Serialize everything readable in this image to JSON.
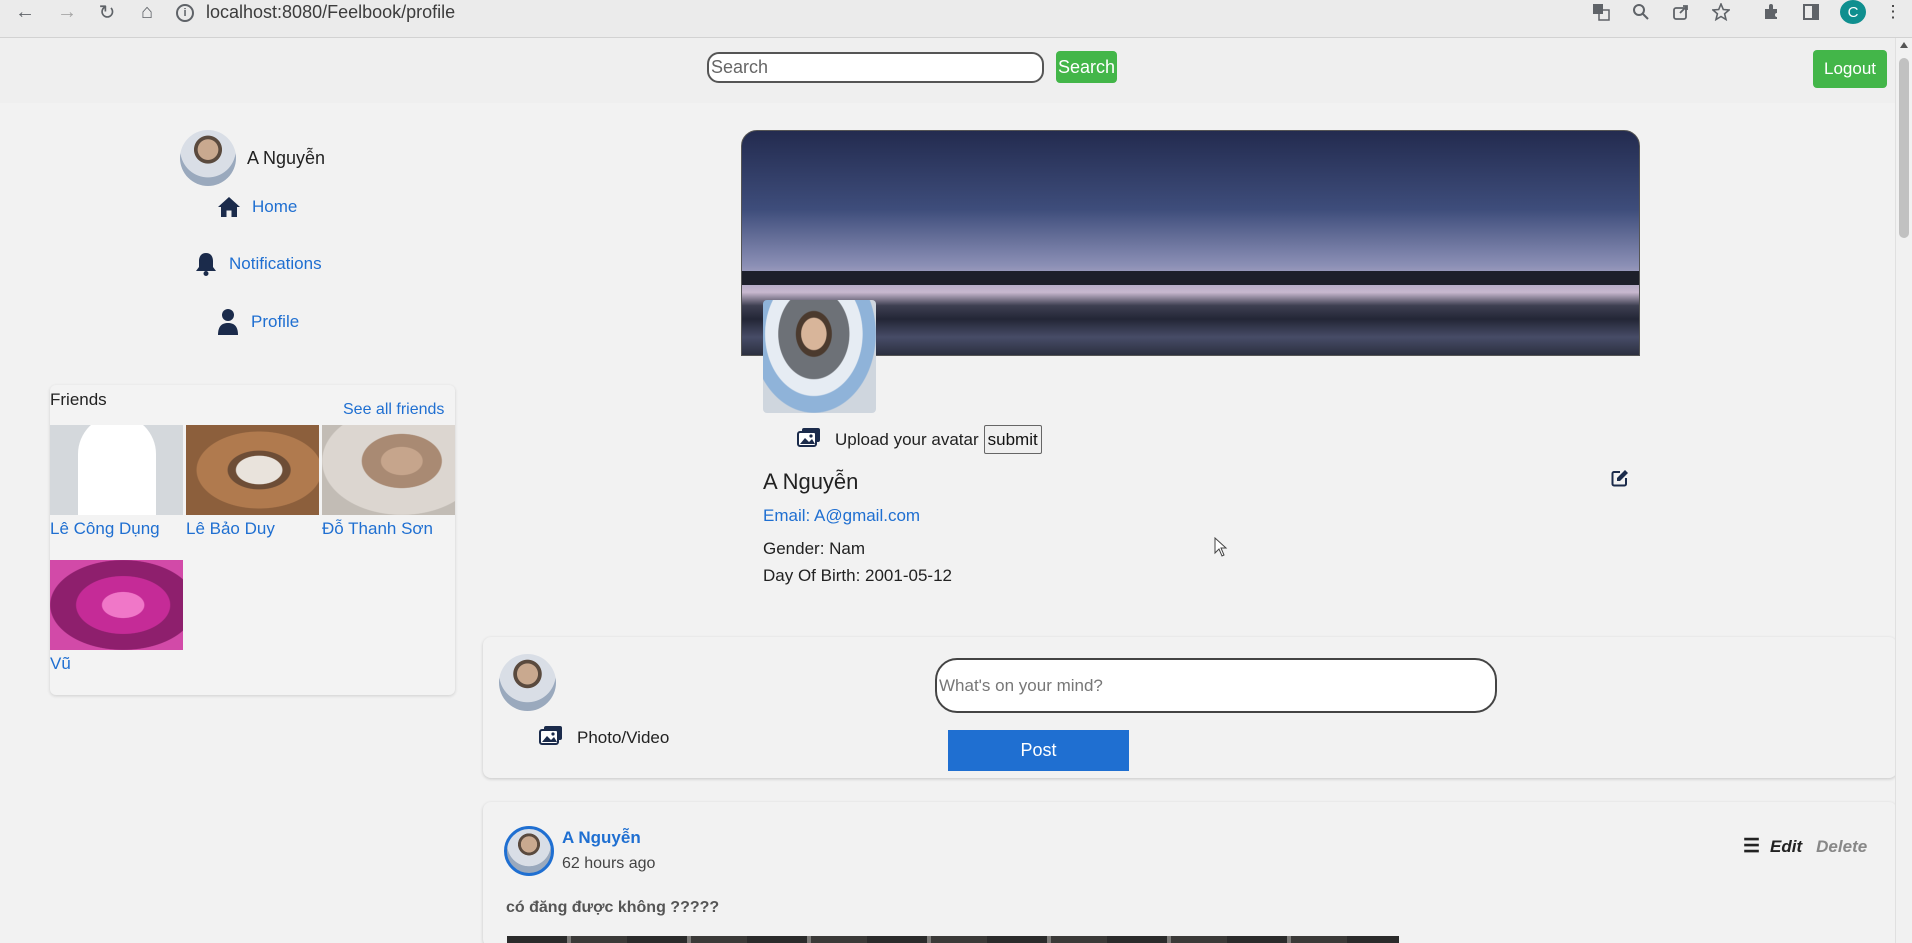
{
  "browser": {
    "url": "localhost:8080/Feelbook/profile",
    "profile_initial": "C",
    "back_icon": "←",
    "forward_icon": "→",
    "reload_icon": "↻",
    "home_icon": "⌂",
    "info_icon": "i",
    "menu_icon": "⋮"
  },
  "header": {
    "search_placeholder": "Search",
    "search_button": "Search",
    "logout_button": "Logout"
  },
  "sidebar": {
    "user_name": "A Nguyễn",
    "items": [
      {
        "label": "Home",
        "icon": "home-icon"
      },
      {
        "label": "Notifications",
        "icon": "bell-icon"
      },
      {
        "label": "Profile",
        "icon": "person-icon"
      }
    ]
  },
  "friends": {
    "title": "Friends",
    "see_all": "See all friends",
    "list": [
      {
        "name": "Lê Công Dụng"
      },
      {
        "name": "Lê Bảo Duy"
      },
      {
        "name": "Đỗ Thanh Sơn"
      },
      {
        "name": "Vũ"
      }
    ]
  },
  "profile": {
    "upload_label": "Upload your avatar",
    "submit_button": "submit",
    "name": "A Nguyễn",
    "email": "Email: A@gmail.com",
    "gender": "Gender: Nam",
    "dob": "Day Of Birth: 2001-05-12"
  },
  "composer": {
    "placeholder": "What's on your mind?",
    "photo_label": "Photo/Video",
    "post_button": "Post"
  },
  "post": {
    "author": "A Nguyễn",
    "time": "62 hours ago",
    "menu_icon": "☰",
    "edit": "Edit",
    "delete": "Delete",
    "content": "có đăng được không ?????"
  },
  "colors": {
    "accent_green": "#43b649",
    "link_blue": "#1f6fd1",
    "page_bg": "#f2f2f2"
  }
}
